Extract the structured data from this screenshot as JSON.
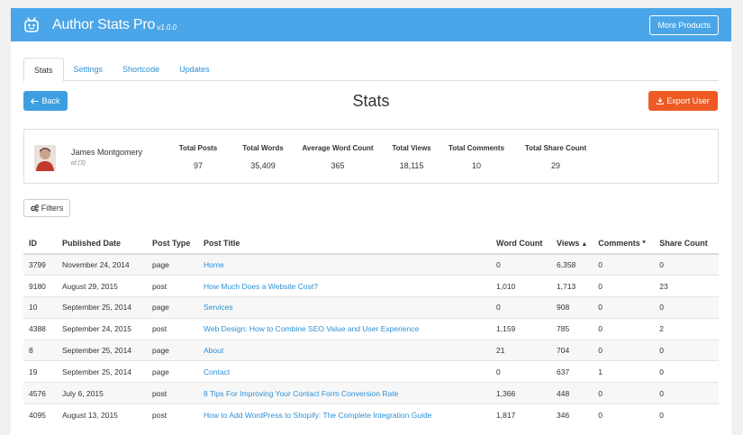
{
  "header": {
    "title": "Author Stats Pro",
    "version": "v1.0.0",
    "more_products": "More Products"
  },
  "tabs": [
    {
      "label": "Stats",
      "active": true
    },
    {
      "label": "Settings",
      "active": false
    },
    {
      "label": "Shortcode",
      "active": false
    },
    {
      "label": "Updates",
      "active": false
    }
  ],
  "toolbar": {
    "back": "Back",
    "page_title": "Stats",
    "export": "Export User"
  },
  "user": {
    "name": "James Montgomery",
    "id": "id:(3)"
  },
  "stats": [
    {
      "label": "Total Posts",
      "value": "97"
    },
    {
      "label": "Total Words",
      "value": "35,409"
    },
    {
      "label": "Average Word Count",
      "value": "365"
    },
    {
      "label": "Total Views",
      "value": "18,115"
    },
    {
      "label": "Total Comments",
      "value": "10"
    },
    {
      "label": "Total Share Count",
      "value": "29"
    }
  ],
  "filters": {
    "label": "Filters"
  },
  "table": {
    "columns": [
      "ID",
      "Published Date",
      "Post Type",
      "Post Title",
      "Word Count",
      "Views",
      "Comments *",
      "Share Count"
    ],
    "rows": [
      [
        "3799",
        "November 24, 2014",
        "page",
        "Home",
        "0",
        "6,358",
        "0",
        "0"
      ],
      [
        "9180",
        "August 29, 2015",
        "post",
        "How Much Does a Website Cost?",
        "1,010",
        "1,713",
        "0",
        "23"
      ],
      [
        "10",
        "September 25, 2014",
        "page",
        "Services",
        "0",
        "908",
        "0",
        "0"
      ],
      [
        "4388",
        "September 24, 2015",
        "post",
        "Web Design: How to Combine SEO Value and User Experience",
        "1,159",
        "785",
        "0",
        "2"
      ],
      [
        "8",
        "September 25, 2014",
        "page",
        "About",
        "21",
        "704",
        "0",
        "0"
      ],
      [
        "19",
        "September 25, 2014",
        "page",
        "Contact",
        "0",
        "637",
        "1",
        "0"
      ],
      [
        "4576",
        "July 6, 2015",
        "post",
        "8 Tips For Improving Your Contact Form Conversion Rate",
        "1,366",
        "448",
        "0",
        "0"
      ],
      [
        "4095",
        "August 13, 2015",
        "post",
        "How to Add WordPress to Shopify: The Complete Integration Guide",
        "1,817",
        "346",
        "0",
        "0"
      ]
    ]
  },
  "colors": {
    "header_bg": "#4aa6e8",
    "back_btn": "#3d9fe0",
    "export_btn": "#ee5a24",
    "link": "#2e90d6"
  }
}
